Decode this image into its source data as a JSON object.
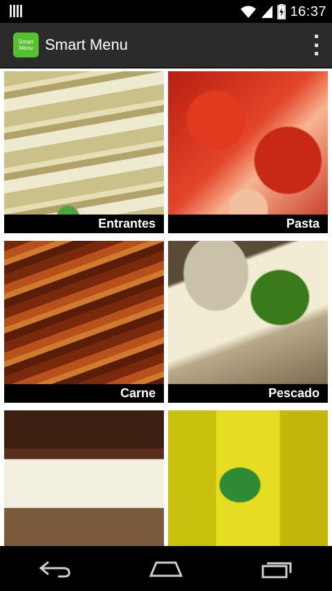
{
  "status_bar": {
    "time": "16:37",
    "icons": [
      "notification-icon",
      "wifi-icon",
      "cell-signal-icon",
      "battery-charging-icon"
    ]
  },
  "app_bar": {
    "logo_text_line1": "Smart",
    "logo_text_line2": "Menu",
    "title": "Smart Menu",
    "overflow_icon": "overflow-menu-icon",
    "brand_color": "#55c12e"
  },
  "menu": {
    "categories": [
      {
        "label": "Entrantes"
      },
      {
        "label": "Pasta"
      },
      {
        "label": "Carne"
      },
      {
        "label": "Pescado"
      },
      {
        "label": ""
      },
      {
        "label": ""
      }
    ]
  },
  "nav_bar": {
    "icons": [
      "back-icon",
      "home-icon",
      "recent-apps-icon"
    ]
  }
}
